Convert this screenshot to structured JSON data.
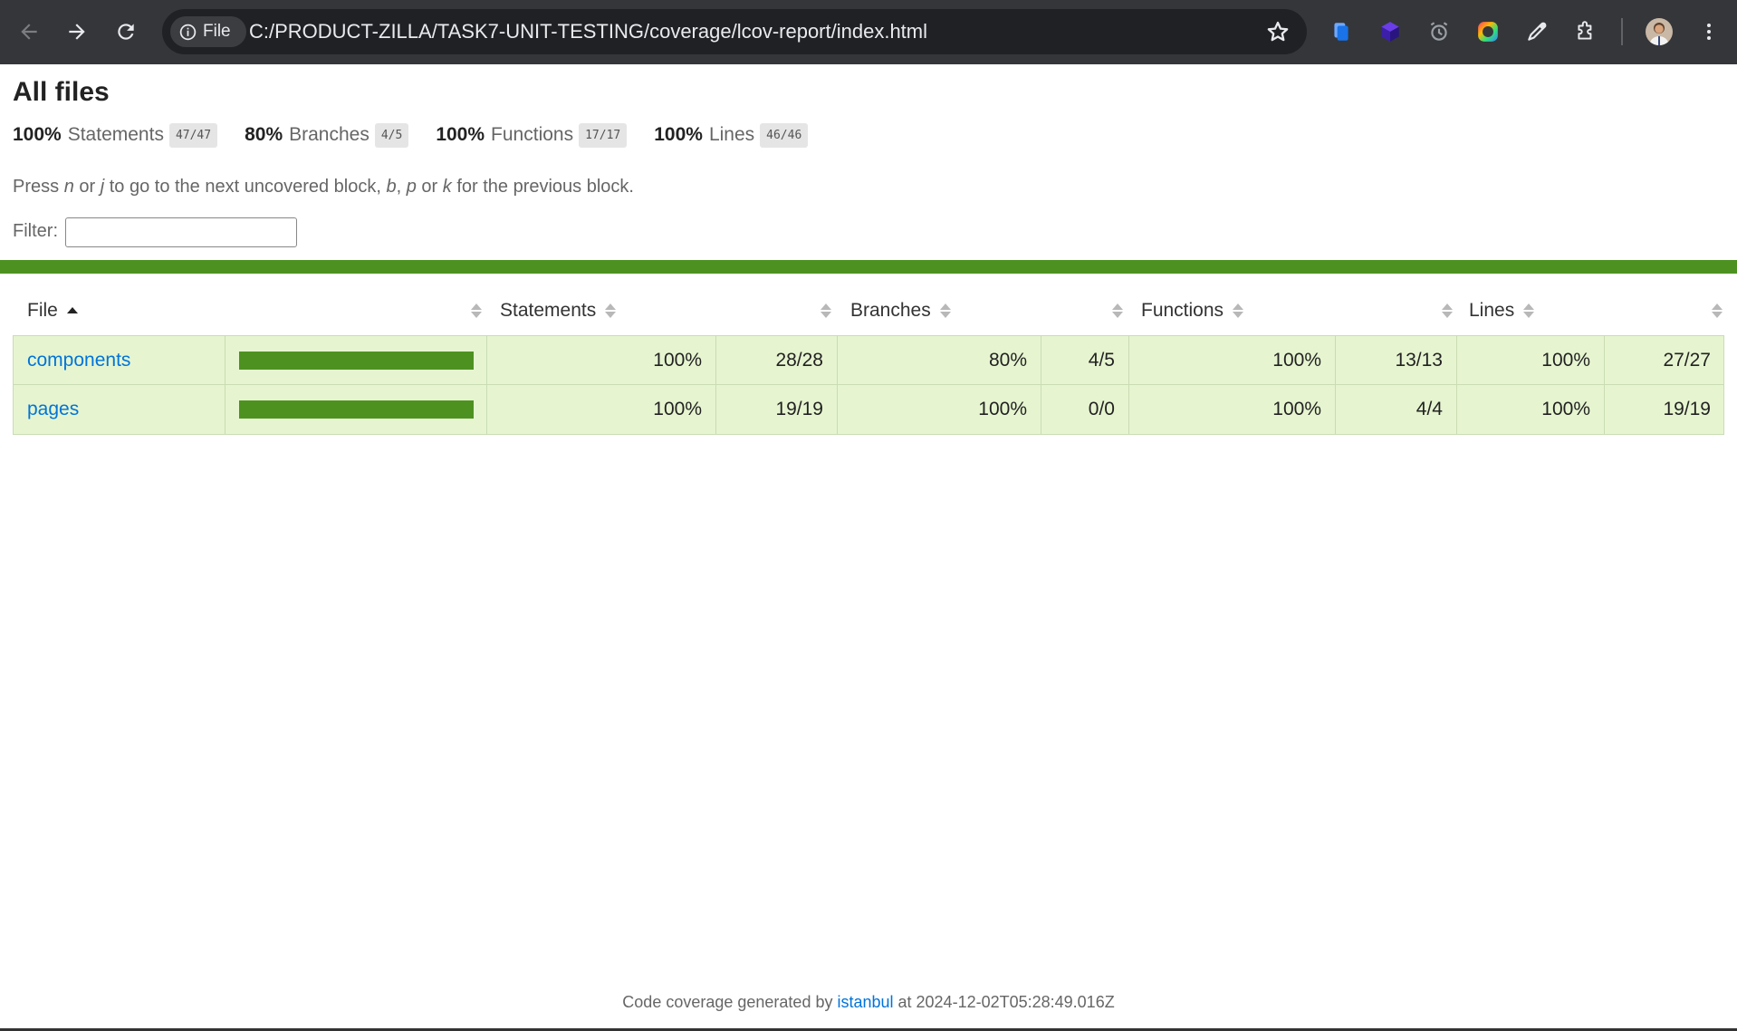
{
  "browser": {
    "site_chip_label": "File",
    "url": "C:/PRODUCT-ZILLA/TASK7-UNIT-TESTING/coverage/lcov-report/index.html"
  },
  "page": {
    "title": "All files",
    "summary": [
      {
        "pct": "100%",
        "label": "Statements",
        "fraction": "47/47"
      },
      {
        "pct": "80%",
        "label": "Branches",
        "fraction": "4/5"
      },
      {
        "pct": "100%",
        "label": "Functions",
        "fraction": "17/17"
      },
      {
        "pct": "100%",
        "label": "Lines",
        "fraction": "46/46"
      }
    ],
    "hint": {
      "t1": "Press ",
      "k1": "n",
      "t2": " or ",
      "k2": "j",
      "t3": " to go to the next uncovered block, ",
      "k3": "b",
      "t4": ", ",
      "k4": "p",
      "t5": " or ",
      "k5": "k",
      "t6": " for the previous block."
    },
    "filter_label": "Filter:",
    "filter_value": "",
    "status_color": "#4d9221",
    "table": {
      "headers": {
        "file": "File",
        "statements": "Statements",
        "branches": "Branches",
        "functions": "Functions",
        "lines": "Lines"
      },
      "rows": [
        {
          "file": "components",
          "coverage_fraction": 1.0,
          "statements_pct": "100%",
          "statements_frac": "28/28",
          "branches_pct": "80%",
          "branches_frac": "4/5",
          "functions_pct": "100%",
          "functions_frac": "13/13",
          "lines_pct": "100%",
          "lines_frac": "27/27"
        },
        {
          "file": "pages",
          "coverage_fraction": 1.0,
          "statements_pct": "100%",
          "statements_frac": "19/19",
          "branches_pct": "100%",
          "branches_frac": "0/0",
          "functions_pct": "100%",
          "functions_frac": "4/4",
          "lines_pct": "100%",
          "lines_frac": "19/19"
        }
      ]
    },
    "footer": {
      "prefix": "Code coverage generated by ",
      "link": "istanbul",
      "suffix": " at 2024-12-02T05:28:49.016Z"
    }
  }
}
